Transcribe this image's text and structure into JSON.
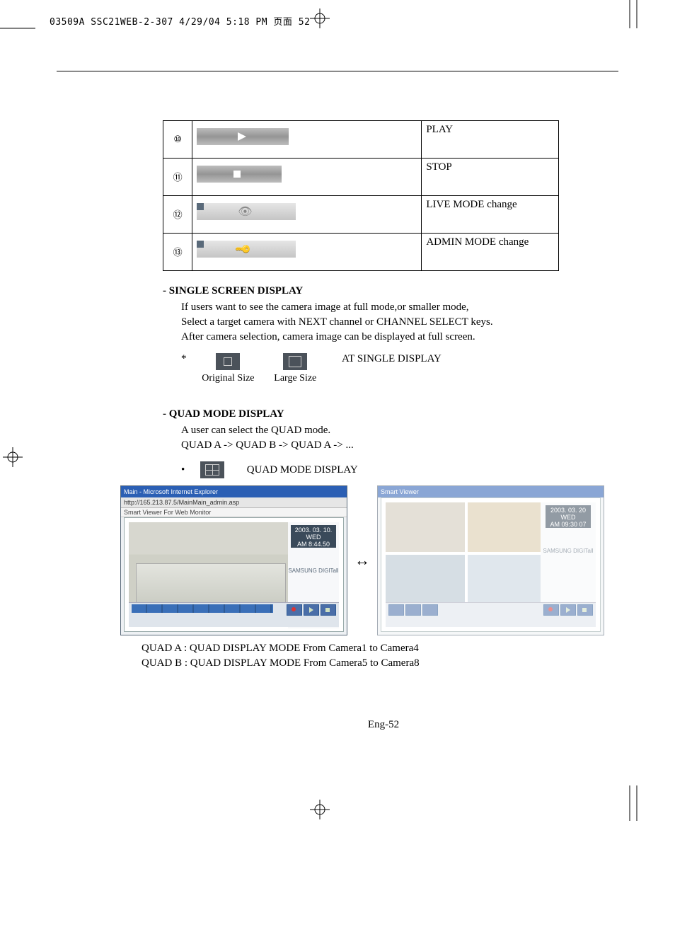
{
  "print_header": "03509A SSC21WEB-2-307  4/29/04  5:18 PM  页面 52",
  "table": {
    "rows": [
      {
        "num": "⑩",
        "desc": "PLAY"
      },
      {
        "num": "⑪",
        "desc": "STOP"
      },
      {
        "num": "⑫",
        "desc": "LIVE MODE change"
      },
      {
        "num": "⑬",
        "desc": "ADMIN MODE change"
      }
    ]
  },
  "section_single": {
    "title": "- SINGLE SCREEN DISPLAY",
    "lines": [
      "If users want to see the camera image at full mode,or smaller mode,",
      "Select a target camera with NEXT channel or CHANNEL SELECT keys.",
      "After camera selection, camera image can be displayed at full screen."
    ],
    "asterisk": "*",
    "at_label": "AT SINGLE DISPLAY",
    "original_size": "Original Size",
    "large_size": "Large Size"
  },
  "section_quad": {
    "title": "- QUAD MODE DISPLAY",
    "lines": [
      "A user can select the QUAD mode.",
      "QUAD A -> QUAD B -> QUAD A -> ..."
    ],
    "bullet": "•",
    "label": "QUAD MODE DISPLAY"
  },
  "screenshot_left": {
    "title": "Main - Microsoft Internet Explorer",
    "address": "http://165.213.87.5/MainMain_admin.asp",
    "tab": "Smart Viewer For Web Monitor",
    "date_line1": "2003. 03. 10. WED",
    "date_line2": "AM 8:44.50",
    "logo": "SAMSUNG DIGITall"
  },
  "screenshot_right": {
    "title": "Smart Viewer",
    "date_line1": "2003. 03. 20 WED",
    "date_line2": "AM 09:30 07",
    "logo": "SAMSUNG DIGITall"
  },
  "arrow": "↔",
  "quad_notes": {
    "a": "QUAD A : QUAD DISPLAY MODE From Camera1 to Camera4",
    "b": "QUAD B : QUAD DISPLAY MODE From Camera5 to Camera8"
  },
  "page_number": "Eng-52"
}
